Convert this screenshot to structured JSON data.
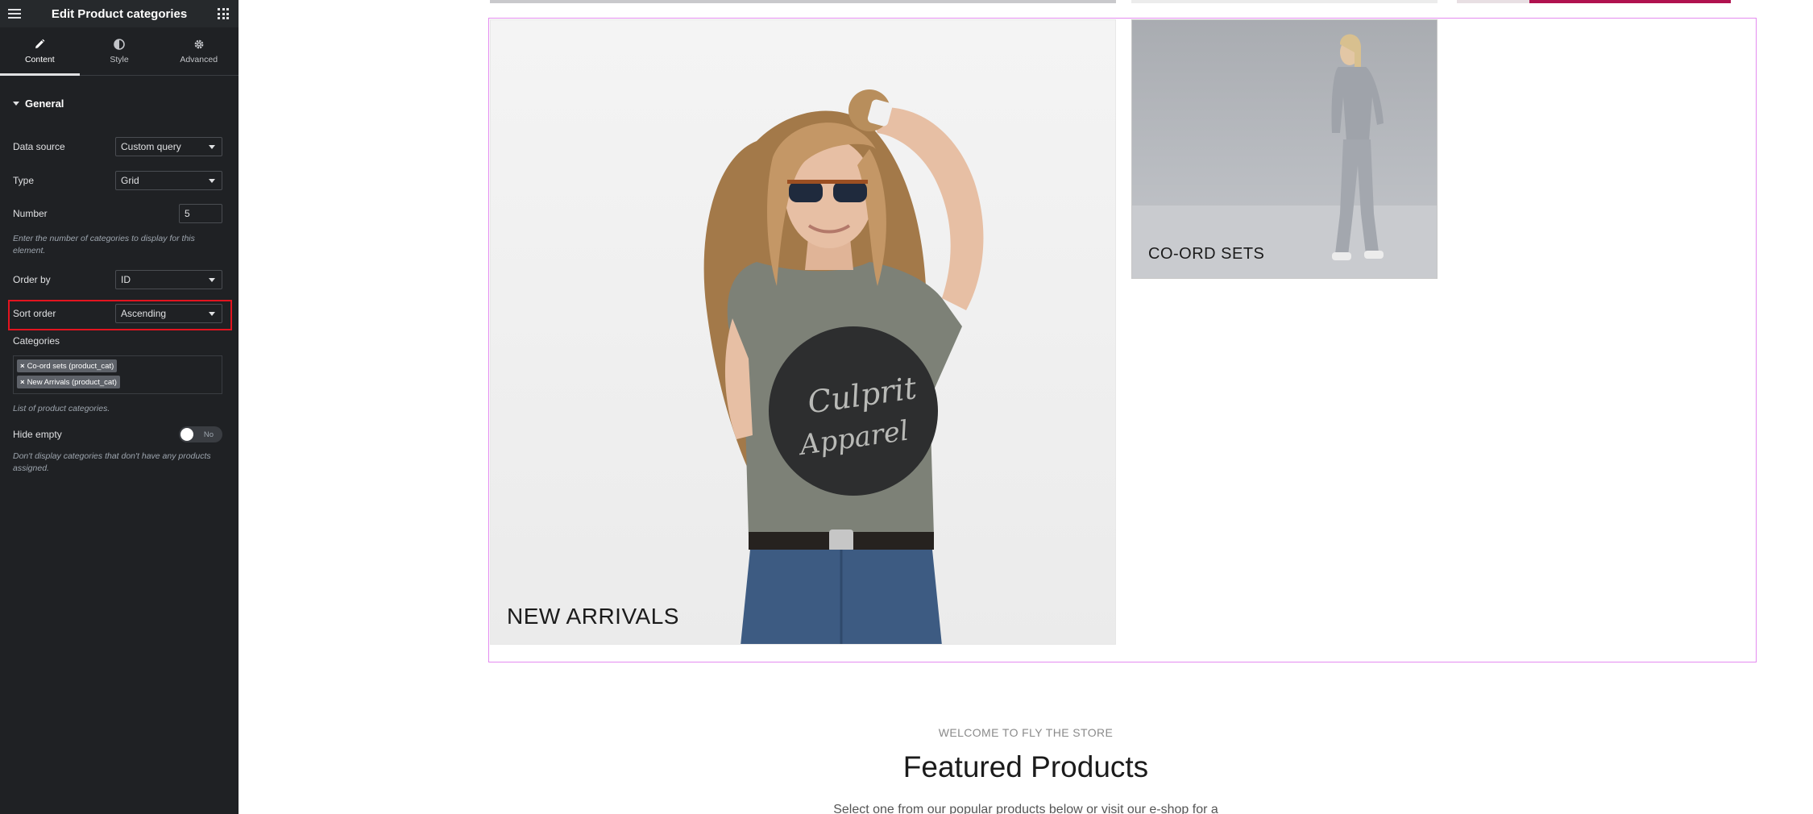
{
  "panel": {
    "title": "Edit Product categories",
    "tabs": [
      {
        "label": "Content",
        "icon": "pencil-icon",
        "active": true
      },
      {
        "label": "Style",
        "icon": "contrast-icon",
        "active": false
      },
      {
        "label": "Advanced",
        "icon": "gear-icon",
        "active": false
      }
    ],
    "section": "General",
    "controls": {
      "data_source": {
        "label": "Data source",
        "value": "Custom query"
      },
      "type": {
        "label": "Type",
        "value": "Grid"
      },
      "number": {
        "label": "Number",
        "value": "5",
        "help": "Enter the number of categories to display for this element."
      },
      "order_by": {
        "label": "Order by",
        "value": "ID"
      },
      "sort_order": {
        "label": "Sort order",
        "value": "Ascending"
      },
      "categories": {
        "label": "Categories",
        "tags": [
          "Co-ord sets (product_cat)",
          "New Arrivals (product_cat)"
        ],
        "help": "List of product categories."
      },
      "hide_empty": {
        "label": "Hide empty",
        "value": "No",
        "help": "Don't display categories that don't have any products assigned."
      }
    }
  },
  "preview": {
    "categories": [
      {
        "name": "NEW ARRIVALS",
        "image": "woman in grey graphic t-shirt and sunglasses"
      },
      {
        "name": "CO-ORD SETS",
        "image": "woman in grey lounge co-ord set"
      }
    ],
    "tshirt_print": "Culprit Apparel",
    "eyebrow": "WELCOME TO FLY THE STORE",
    "heading": "Featured Products",
    "intro": "Select one from our popular products below or visit our e-shop for a"
  },
  "colors": {
    "panel_bg": "#1f2124",
    "highlight_red": "#e3141f",
    "widget_outline": "#e48cf0"
  }
}
